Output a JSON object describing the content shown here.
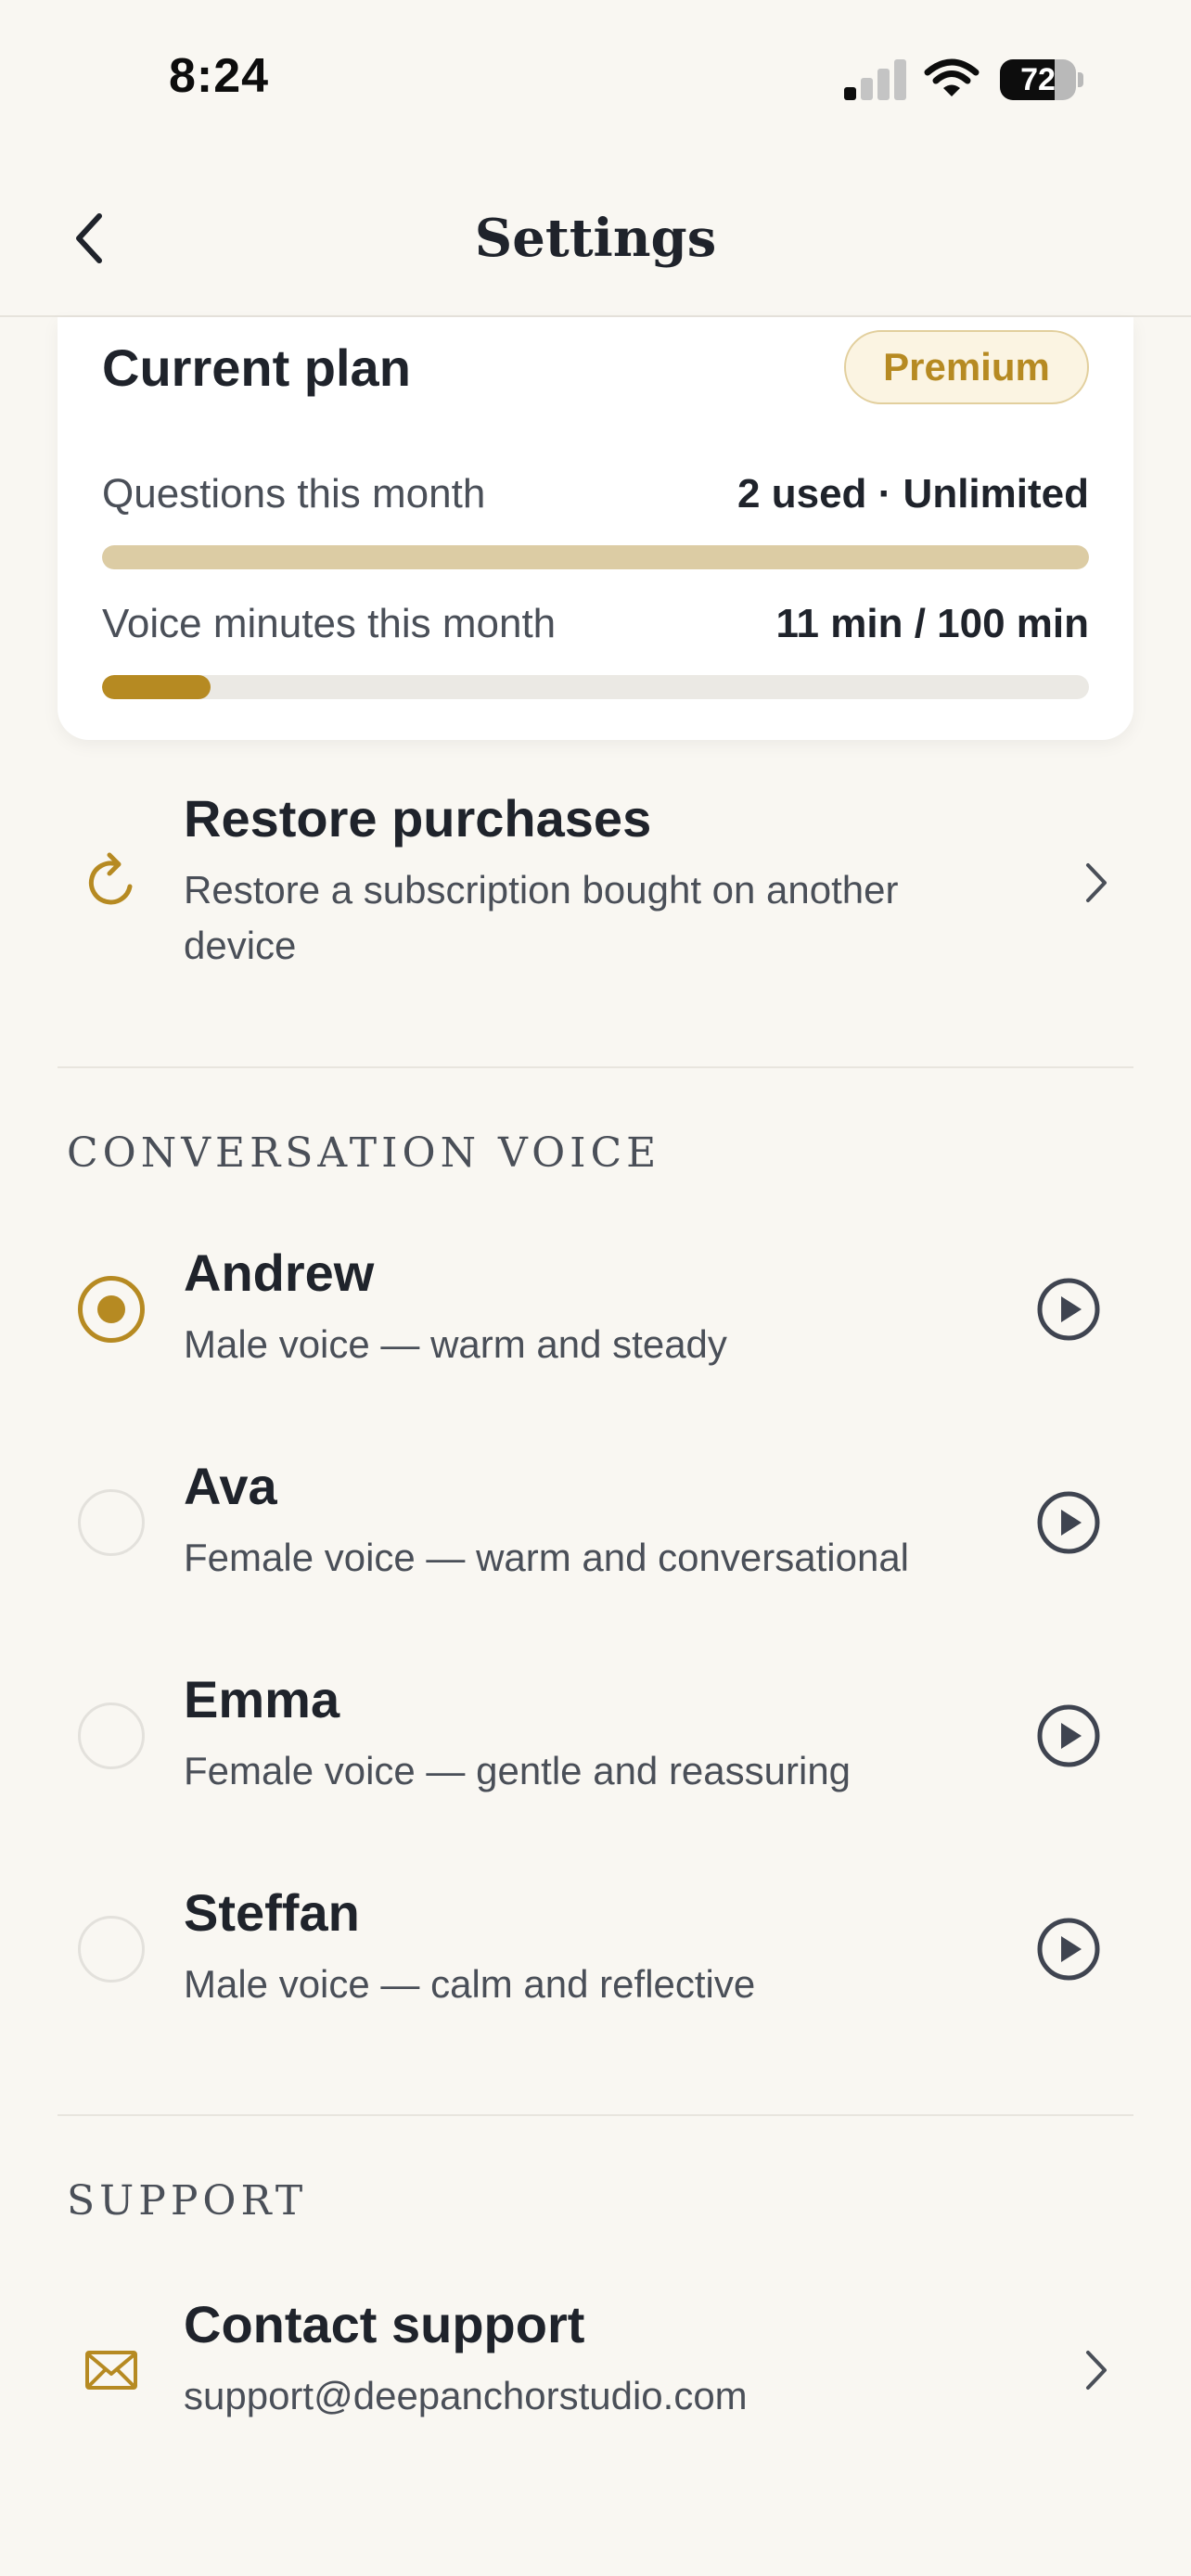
{
  "status_bar": {
    "time": "8:24",
    "battery": "72",
    "battery_level": 0.72
  },
  "nav": {
    "title": "Settings"
  },
  "plan": {
    "title": "Current plan",
    "badge": "Premium",
    "questions": {
      "label": "Questions this month",
      "value": "2 used · Unlimited",
      "fill": 1.0,
      "color": "#dccca4"
    },
    "voice_minutes": {
      "label": "Voice minutes this month",
      "value": "11 min / 100 min",
      "fill": 0.11,
      "color": "#b68a22"
    }
  },
  "restore": {
    "title": "Restore purchases",
    "subtitle": "Restore a subscription bought on another device"
  },
  "voice_section": {
    "header": "CONVERSATION VOICE",
    "voices": [
      {
        "name": "Andrew",
        "description": "Male voice — warm and steady",
        "selected": true
      },
      {
        "name": "Ava",
        "description": "Female voice — warm and conversational",
        "selected": false
      },
      {
        "name": "Emma",
        "description": "Female voice — gentle and reassuring",
        "selected": false
      },
      {
        "name": "Steffan",
        "description": "Male voice — calm and reflective",
        "selected": false
      }
    ]
  },
  "support_section": {
    "header": "SUPPORT",
    "contact": {
      "title": "Contact support",
      "email": "support@deepanchorstudio.com"
    }
  },
  "colors": {
    "accent": "#b68a22",
    "background": "#f9f7f2",
    "card": "#ffffff",
    "text": "#1f232b",
    "muted": "#4a4f58"
  }
}
